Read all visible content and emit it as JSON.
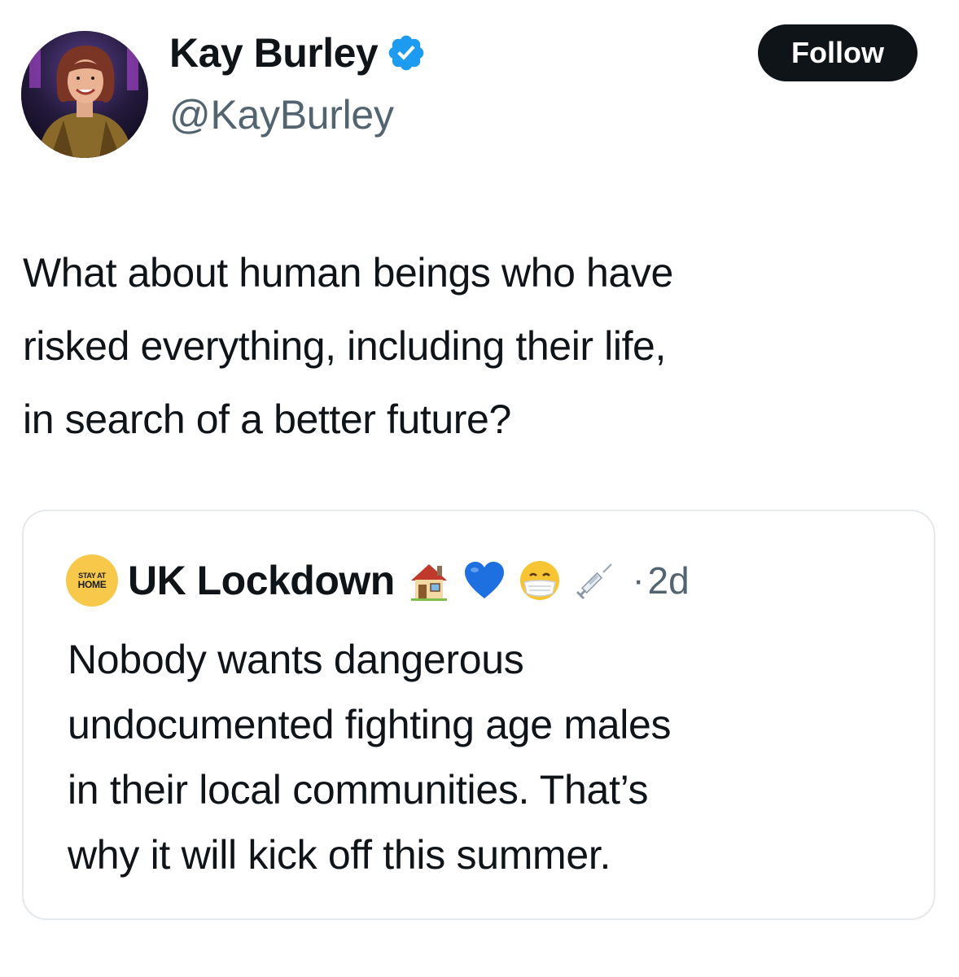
{
  "author": {
    "display_name": "Kay Burley",
    "handle": "@KayBurley",
    "verified": true,
    "avatar_icon": "profile-photo"
  },
  "actions": {
    "follow_label": "Follow"
  },
  "tweet": {
    "lines": [
      "What about human beings who have",
      "risked everything, including their life,",
      "in search of a better future?"
    ]
  },
  "quoted_tweet": {
    "author_name": "UK Lockdown",
    "avatar_text_line1": "STAY AT",
    "avatar_text_line2": "HOME",
    "name_emojis": [
      "house-emoji",
      "blue-heart-emoji",
      "face-with-mask-emoji",
      "syringe-emoji"
    ],
    "separator": "·",
    "timestamp": "2d",
    "lines": [
      "Nobody wants dangerous",
      "undocumented fighting age males",
      "in their local communities. That’s",
      "why it will kick off this summer."
    ]
  },
  "colors": {
    "text_primary": "#0f1419",
    "text_secondary": "#536471",
    "verified_blue": "#1d9bf0",
    "follow_bg": "#0f1419",
    "card_border": "#e6e9ec",
    "quote_avatar_bg": "#f7c84a"
  }
}
